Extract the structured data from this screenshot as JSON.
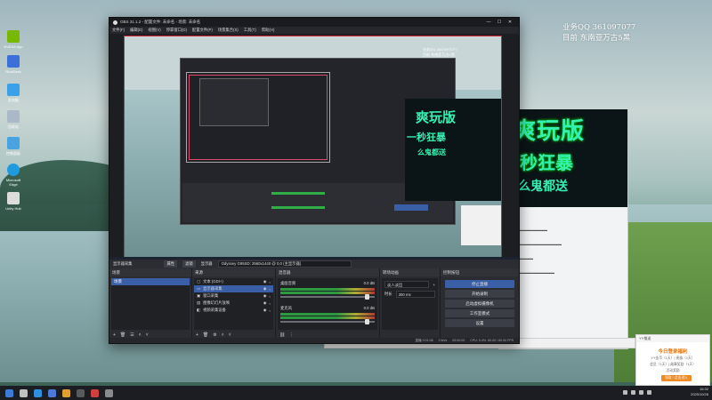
{
  "desktop": {
    "icons": [
      {
        "label": "NVIDIA App",
        "color": "#76b900"
      },
      {
        "label": "RustDesk",
        "color": "#3d6fd8"
      },
      {
        "label": "此电脑",
        "color": "#3aa0e8"
      },
      {
        "label": "回收站",
        "color": "#aab8c8"
      },
      {
        "label": "控制面板",
        "color": "#4aa3e0"
      },
      {
        "label": "Microsoft Edge",
        "color": "#1e9adf"
      },
      {
        "label": "Unity Hub",
        "color": "#dddddd"
      }
    ],
    "watermark": {
      "line1": "业务QQ 361097077",
      "line2": "目前 东南亚万古5黑"
    }
  },
  "obs": {
    "title": "OBS 31.1.2 - 配置文件: 未命名 - 场景: 未命名",
    "menu": [
      "文件(F)",
      "编辑(E)",
      "视图(V)",
      "停靠窗口(D)",
      "配置文件(P)",
      "场景集合(S)",
      "工具(T)",
      "帮助(H)"
    ],
    "window_buttons": [
      "—",
      "☐",
      "✕"
    ],
    "profile_bar": {
      "scene_label": "显示器采集",
      "props": "属性",
      "filters": "滤镜",
      "device_label": "显示器",
      "device_value": "Odyssey G95SD: 2560x1440 @ 0,0 (主显示器)"
    },
    "scenes": {
      "title": "场景",
      "items": [
        "场景"
      ]
    },
    "sources": {
      "title": "来源",
      "items": [
        {
          "name": "文本 (GDI+)",
          "selected": false
        },
        {
          "name": "显示器采集",
          "selected": true
        },
        {
          "name": "窗口采集",
          "selected": false
        },
        {
          "name": "图像幻灯片放映",
          "selected": false
        },
        {
          "name": "视频采集设备",
          "selected": false
        }
      ]
    },
    "mixer": {
      "title": "混音器",
      "channels": [
        {
          "name": "桌面音频",
          "db": "0.0 dB"
        },
        {
          "name": "麦克风",
          "db": "0.0 dB"
        }
      ]
    },
    "transitions": {
      "title": "转场动画",
      "type": "淡入淡出",
      "duration_label": "时长",
      "duration": "300 ms"
    },
    "controls": {
      "title": "控制按钮",
      "buttons": [
        {
          "label": "停止直播",
          "primary": true
        },
        {
          "label": "开始录制",
          "primary": false
        },
        {
          "label": "启动虚拟摄像机",
          "primary": false
        },
        {
          "label": "工作室模式",
          "primary": false
        },
        {
          "label": "设置",
          "primary": false
        }
      ]
    },
    "status": {
      "live": "直播 0:01:08",
      "rec": "00:00:00",
      "cpu": "CPU: 0.4%, 60.00 / 60.00 FPS",
      "kbps": "0 kb/s"
    }
  },
  "game_ad": {
    "line1": "爽玩版",
    "line2": "一秒狂暴",
    "line3": "么鬼都送"
  },
  "notification": {
    "header": "YY推送",
    "title": "今日登录福利",
    "line1": "YY金币（1天）| 贵族（1天）",
    "line2": "会员（1天）| 勋章奖励（1天）",
    "line3": "活动奖励",
    "button": "领取 / 点击进入"
  },
  "taskbar": {
    "time": "16:32",
    "date": "2025/10/28",
    "icons": [
      "#3a7bd5",
      "#c0c0c0",
      "#2f8fdf",
      "#4b7bd6",
      "#e0a030",
      "#5a5a5a",
      "#d04040",
      "#8a8a8a"
    ]
  }
}
